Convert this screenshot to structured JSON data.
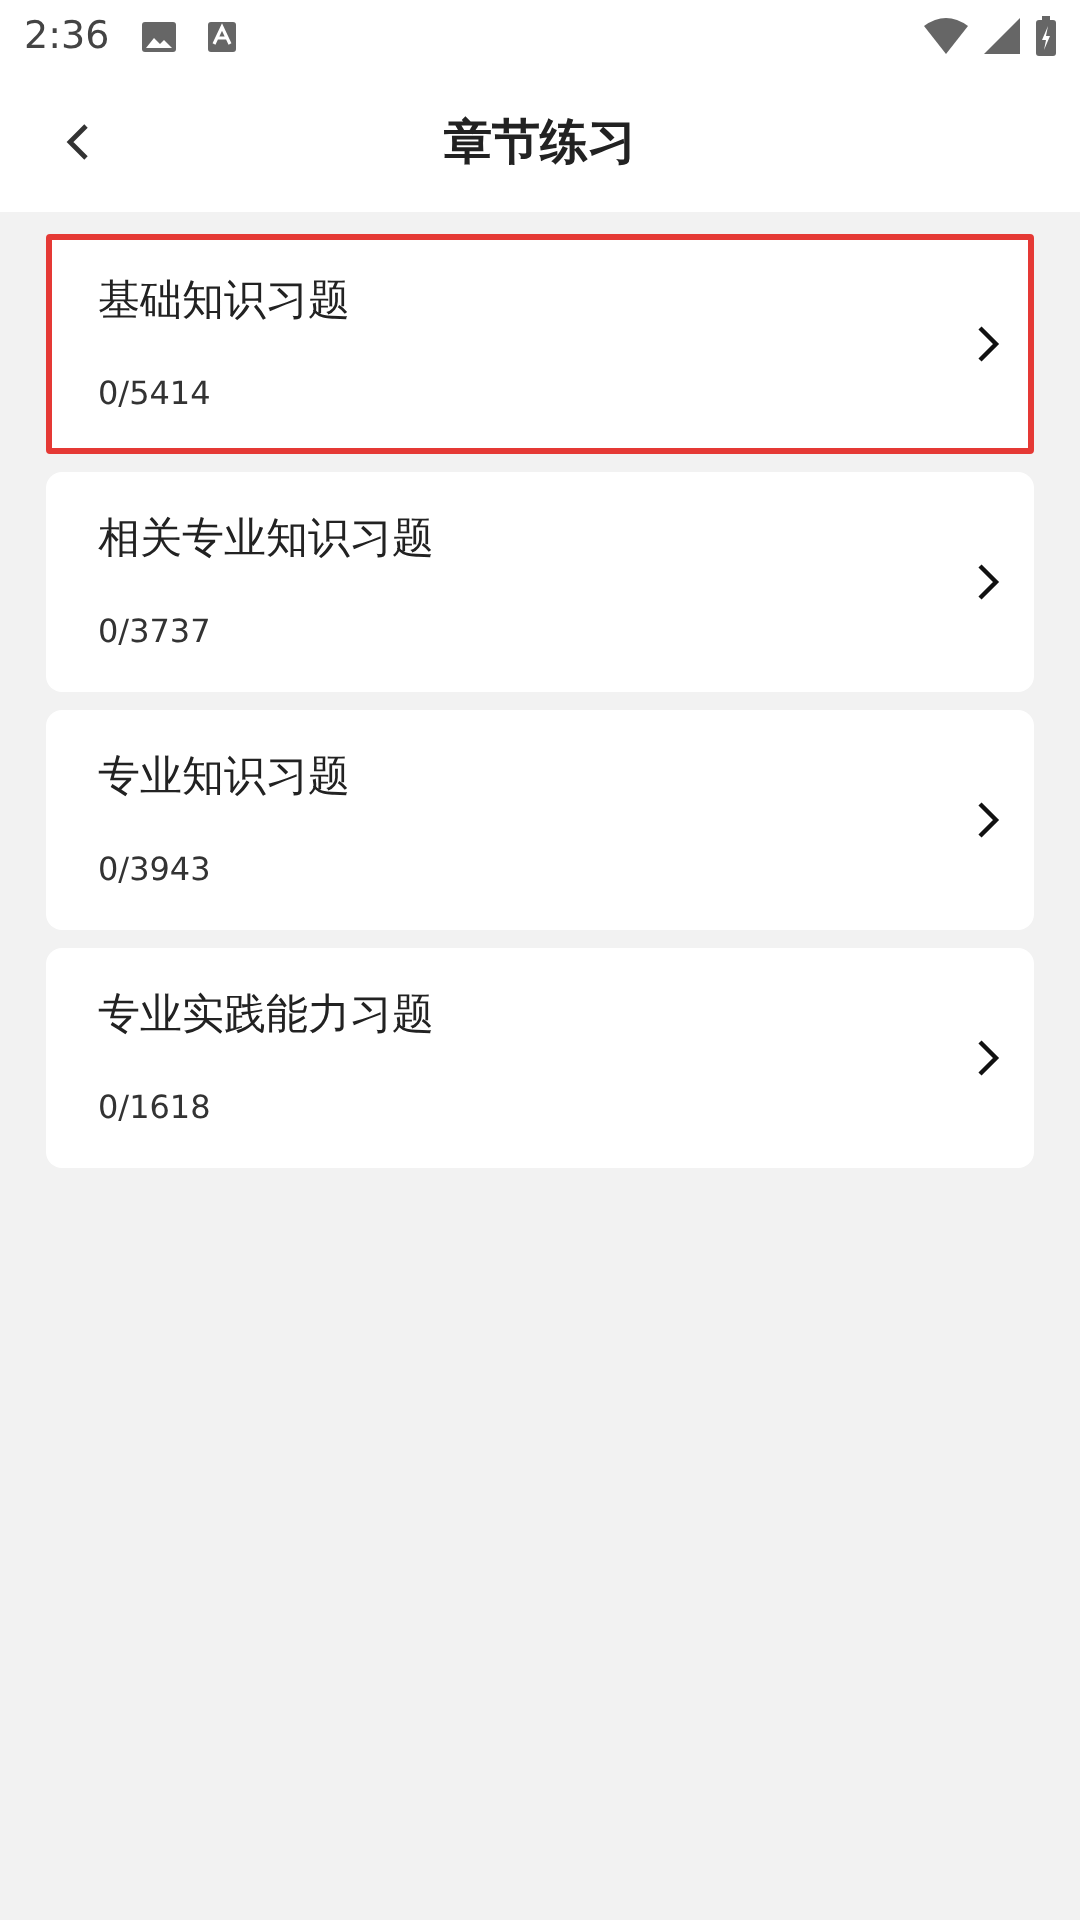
{
  "status_bar": {
    "time": "2:36"
  },
  "header": {
    "title": "章节练习"
  },
  "chapters": [
    {
      "title": "基础知识习题",
      "progress": "0/5414",
      "highlighted": true
    },
    {
      "title": "相关专业知识习题",
      "progress": "0/3737",
      "highlighted": false
    },
    {
      "title": "专业知识习题",
      "progress": "0/3943",
      "highlighted": false
    },
    {
      "title": "专业实践能力习题",
      "progress": "0/1618",
      "highlighted": false
    }
  ]
}
